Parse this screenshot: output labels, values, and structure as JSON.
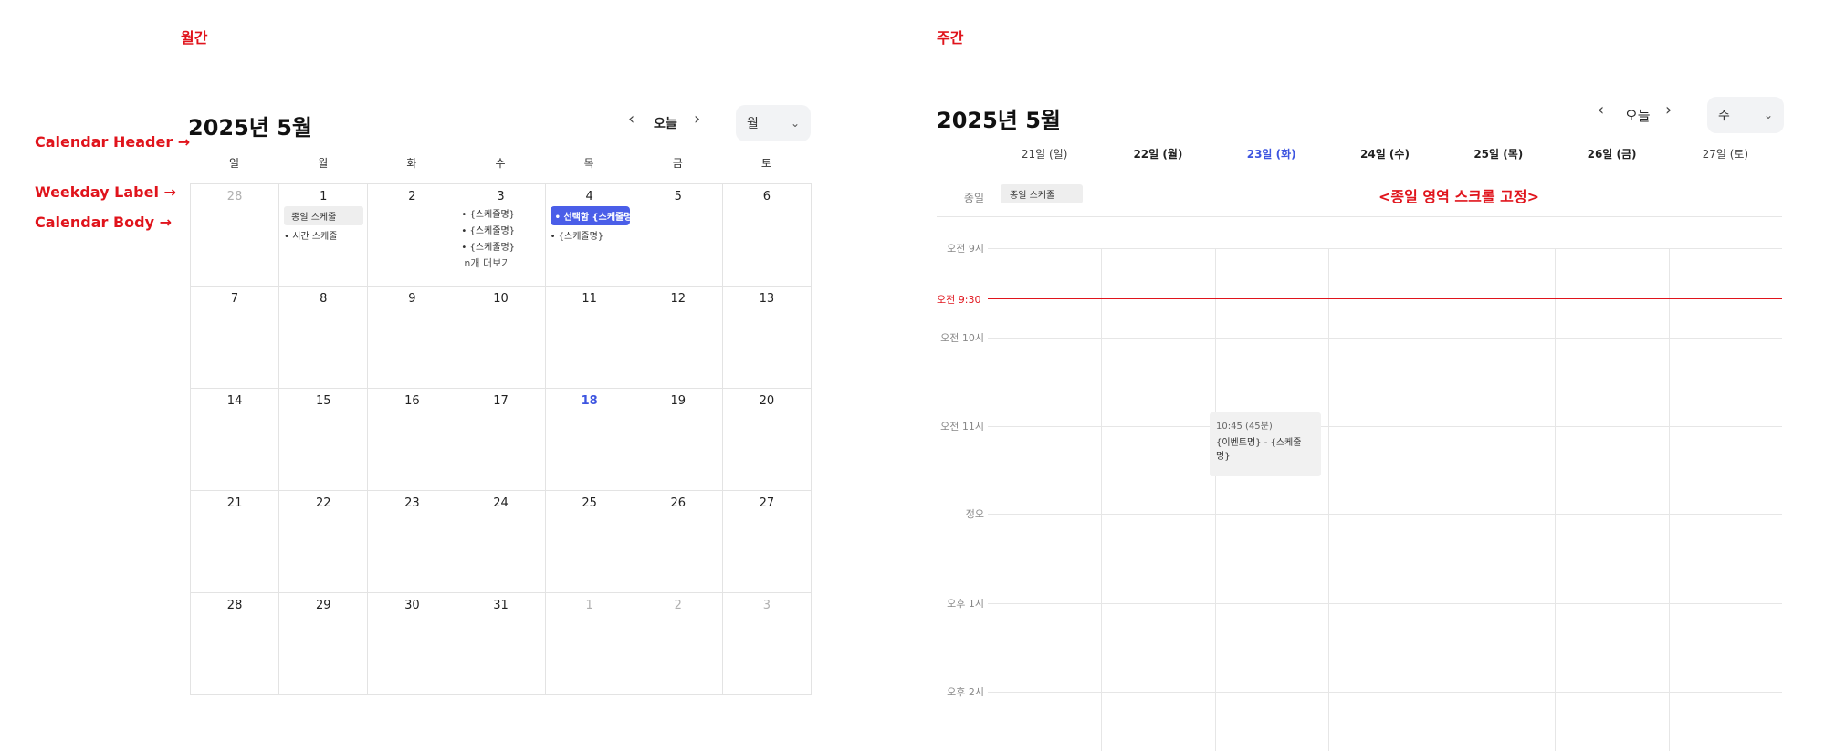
{
  "sections": {
    "monthly": "월간",
    "weekly": "주간"
  },
  "annotations": {
    "header": "Calendar Header →",
    "weekday": "Weekday Label →",
    "body": "Calendar Body →",
    "allday_fixed": "<종일 영역 스크롤 고정>"
  },
  "monthly": {
    "title": "2025년 5월",
    "today": "오늘",
    "view": "월",
    "prev_icon": "‹",
    "next_icon": "›",
    "weekdays": [
      "일",
      "월",
      "화",
      "수",
      "목",
      "금",
      "토"
    ],
    "weeks": [
      [
        {
          "d": "28",
          "other": true
        },
        {
          "d": "1",
          "events": [
            {
              "text": "종일 스케줄",
              "type": "allday"
            },
            {
              "text": "시간 스케줄",
              "type": "timed"
            }
          ]
        },
        {
          "d": "2"
        },
        {
          "d": "3",
          "events": [
            {
              "text": "{스케줄명}",
              "type": "timed"
            },
            {
              "text": "{스케줄명}",
              "type": "timed"
            },
            {
              "text": "{스케줄명}",
              "type": "timed"
            },
            {
              "text": "n개 더보기",
              "type": "more"
            }
          ]
        },
        {
          "d": "4",
          "events": [
            {
              "text": "선택함 {스케줄명}",
              "type": "selected"
            },
            {
              "text": "{스케줄명}",
              "type": "timed"
            }
          ]
        },
        {
          "d": "5"
        },
        {
          "d": "6"
        }
      ],
      [
        {
          "d": "7"
        },
        {
          "d": "8"
        },
        {
          "d": "9"
        },
        {
          "d": "10"
        },
        {
          "d": "11"
        },
        {
          "d": "12"
        },
        {
          "d": "13"
        }
      ],
      [
        {
          "d": "14"
        },
        {
          "d": "15"
        },
        {
          "d": "16"
        },
        {
          "d": "17"
        },
        {
          "d": "18",
          "today": true
        },
        {
          "d": "19"
        },
        {
          "d": "20"
        }
      ],
      [
        {
          "d": "21"
        },
        {
          "d": "22"
        },
        {
          "d": "23"
        },
        {
          "d": "24"
        },
        {
          "d": "25"
        },
        {
          "d": "26"
        },
        {
          "d": "27"
        }
      ],
      [
        {
          "d": "28"
        },
        {
          "d": "29"
        },
        {
          "d": "30"
        },
        {
          "d": "31"
        },
        {
          "d": "1",
          "other": true
        },
        {
          "d": "2",
          "other": true
        },
        {
          "d": "3",
          "other": true
        }
      ]
    ]
  },
  "weekly": {
    "title": "2025년 5월",
    "today": "오늘",
    "view": "주",
    "prev_icon": "‹",
    "next_icon": "›",
    "days": [
      {
        "label": "21일 (일)",
        "kind": "sun"
      },
      {
        "label": "22일 (월)"
      },
      {
        "label": "23일 (화)",
        "kind": "today"
      },
      {
        "label": "24일 (수)"
      },
      {
        "label": "25일 (목)"
      },
      {
        "label": "26일 (금)"
      },
      {
        "label": "27일 (토)",
        "kind": "sat"
      }
    ],
    "allday_label": "종일",
    "allday_chip": "종일 스케줄",
    "times": [
      "오전 9시",
      "오전 10시",
      "오전 11시",
      "정오",
      "오후 1시",
      "오후 2시"
    ],
    "now_label": "오전 9:30",
    "event": {
      "time": "10:45 (45분)",
      "title": "{이벤트명} - {스케줄명}"
    }
  },
  "colors": {
    "accent": "#3d55e0",
    "selected": "#4a5ee8",
    "now_line": "#e0141c",
    "annotation": "#e0141c"
  }
}
